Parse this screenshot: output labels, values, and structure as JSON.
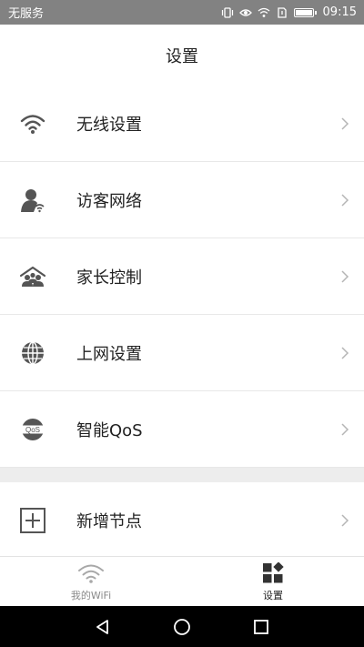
{
  "status_bar": {
    "carrier": "无服务",
    "time": "09:15",
    "icons": [
      "vibrate-icon",
      "eye-icon",
      "wifi-icon",
      "sim-icon",
      "battery-icon"
    ]
  },
  "title": "设置",
  "menu_items": [
    {
      "label": "无线设置",
      "icon": "wifi-icon"
    },
    {
      "label": "访客网络",
      "icon": "guest-user-icon"
    },
    {
      "label": "家长控制",
      "icon": "parental-control-icon"
    },
    {
      "label": "上网设置",
      "icon": "globe-icon"
    },
    {
      "label": "智能QoS",
      "icon": "qos-icon",
      "icon_text": "QoS"
    },
    {
      "label": "新增节点",
      "icon": "add-node-icon"
    }
  ],
  "bottom_nav": {
    "tabs": [
      {
        "label": "我的WiFi",
        "icon": "wifi-icon",
        "active": false
      },
      {
        "label": "设置",
        "icon": "settings-grid-icon",
        "active": true
      }
    ]
  },
  "colors": {
    "status_bar_bg": "#828282",
    "icon_color": "#555555",
    "separator": "#ededed"
  }
}
